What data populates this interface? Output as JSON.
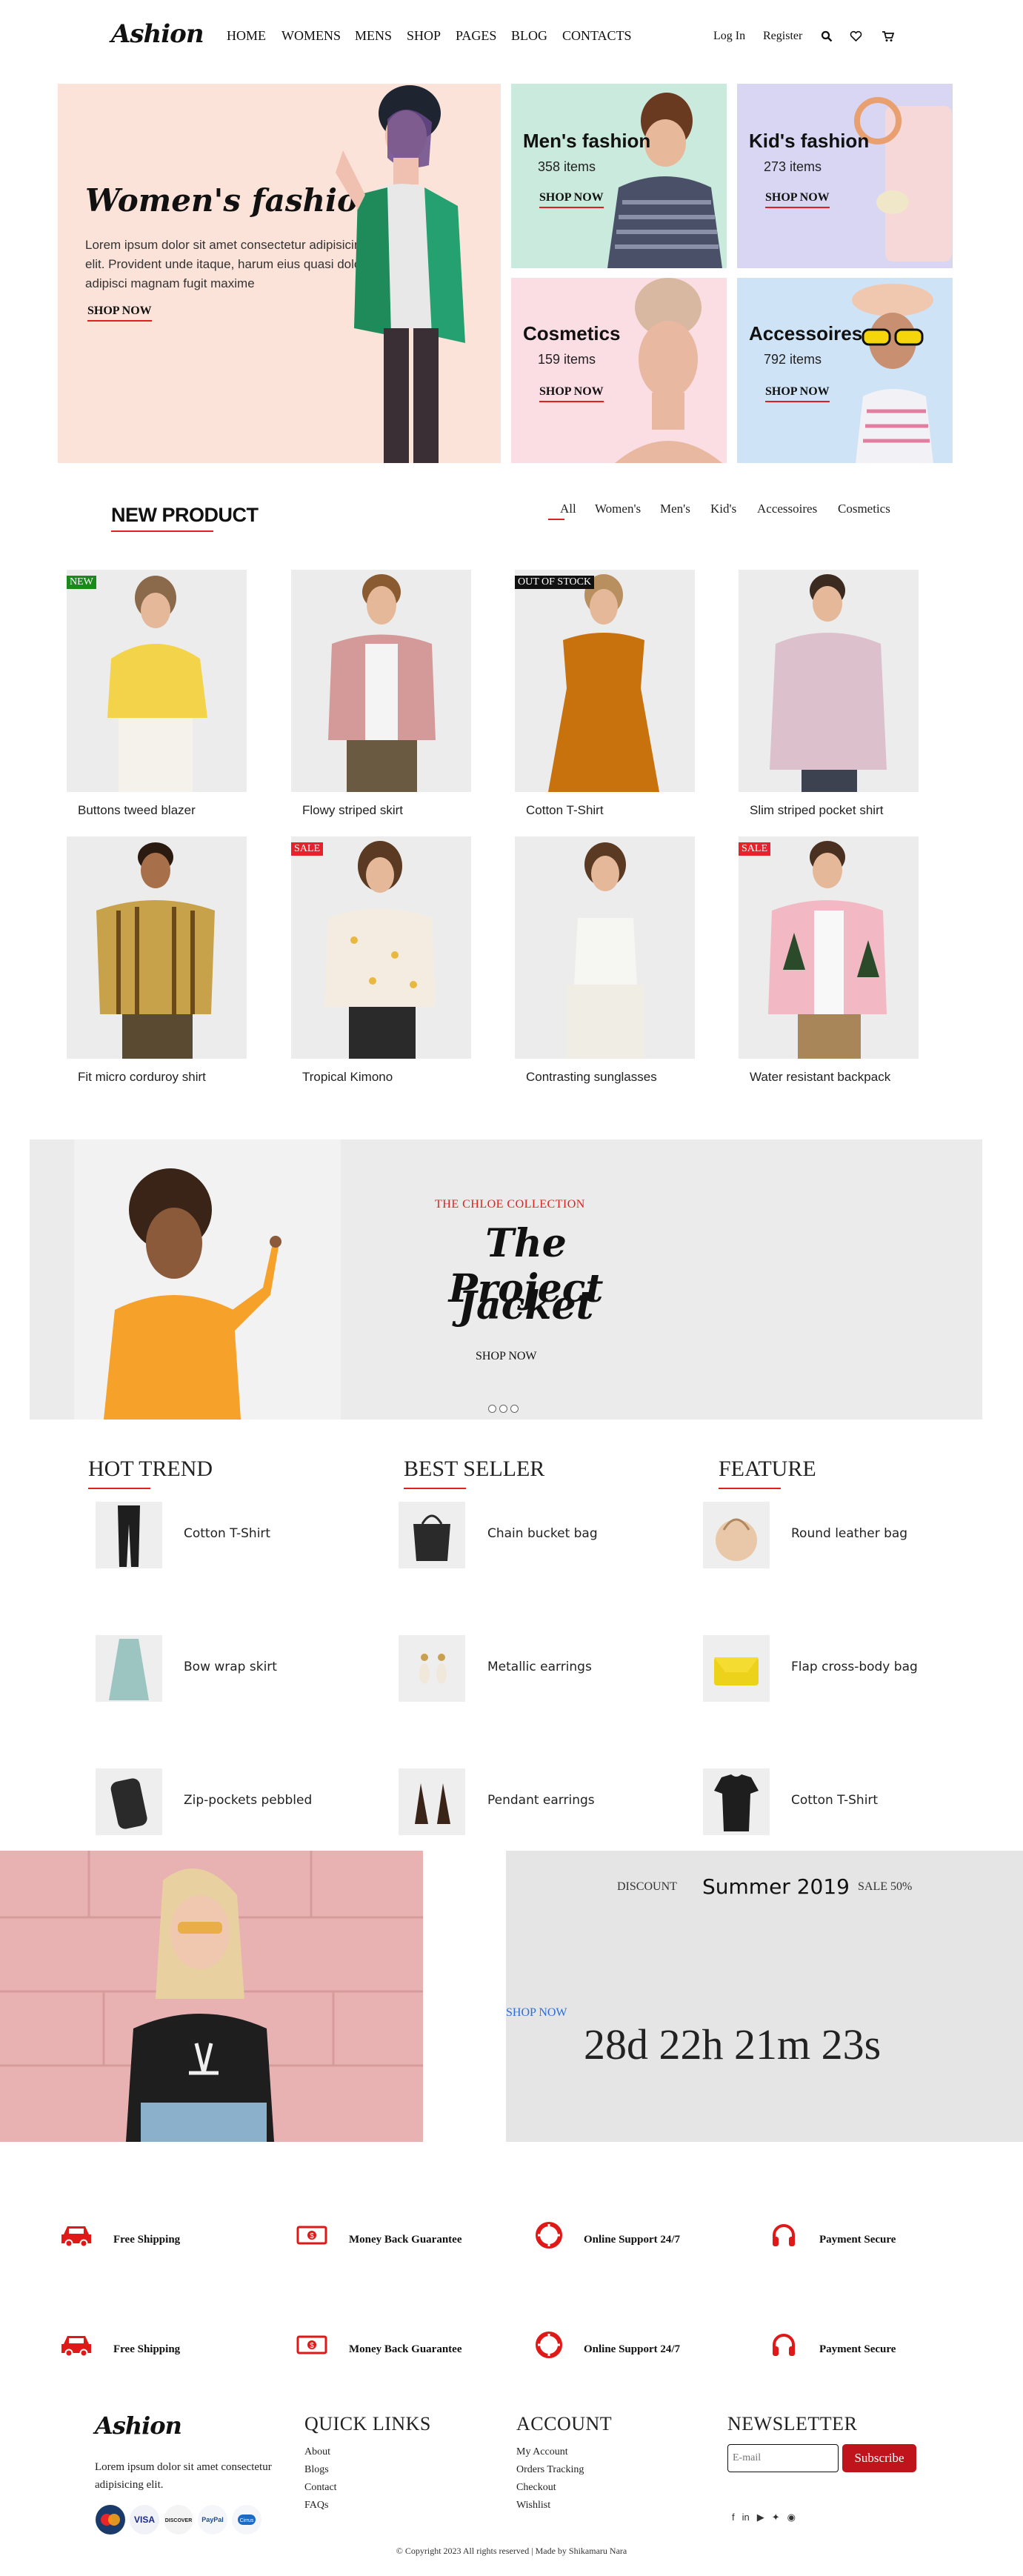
{
  "header": {
    "logo": "Ashion",
    "nav": [
      "HOME",
      "WOMENS",
      "MENS",
      "SHOP",
      "PAGES",
      "BLOG",
      "CONTACTS"
    ],
    "login": "Log In",
    "register": "Register"
  },
  "hero": {
    "main": {
      "title": "Women's fashion",
      "text": "Lorem ipsum dolor sit amet consectetur adipisicing elit. Provident unde itaque, harum eius quasi dolor no adipisci magnam fugit maxime",
      "cta": "SHOP NOW"
    },
    "tiles": [
      {
        "title": "Men's fashion",
        "count": "358 items",
        "cta": "SHOP NOW",
        "bg": "#c9eadc"
      },
      {
        "title": "Kid's fashion",
        "count": "273 items",
        "cta": "SHOP NOW",
        "bg": "#d8d6f3"
      },
      {
        "title": "Cosmetics",
        "count": "159 items",
        "cta": "SHOP NOW",
        "bg": "#fbdde4"
      },
      {
        "title": "Accessoires",
        "count": "792 items",
        "cta": "SHOP NOW",
        "bg": "#cee3f6"
      }
    ]
  },
  "new_product": {
    "title": "NEW PRODUCT",
    "filters": [
      "All",
      "Women's",
      "Men's",
      "Kid's",
      "Accessoires",
      "Cosmetics"
    ],
    "products": [
      {
        "name": "Buttons tweed blazer",
        "badge": "NEW"
      },
      {
        "name": "Flowy striped skirt",
        "badge": ""
      },
      {
        "name": "Cotton T-Shirt",
        "badge": "OUT OF STOCK"
      },
      {
        "name": "Slim striped pocket shirt",
        "badge": ""
      },
      {
        "name": "Fit micro corduroy shirt",
        "badge": ""
      },
      {
        "name": "Tropical Kimono",
        "badge": "SALE"
      },
      {
        "name": "Contrasting sunglasses",
        "badge": ""
      },
      {
        "name": "Water resistant backpack",
        "badge": "SALE"
      }
    ]
  },
  "banner": {
    "eyebrow": "THE CHLOE COLLECTION",
    "title_line1": "The Project",
    "title_line2": "Jacket",
    "cta": "SHOP NOW"
  },
  "lists": [
    {
      "title": "HOT TREND",
      "items": [
        "Cotton T-Shirt",
        "Bow wrap skirt",
        "Zip-pockets pebbled"
      ]
    },
    {
      "title": "BEST SELLER",
      "items": [
        "Chain bucket bag",
        "Metallic earrings",
        "Pendant earrings"
      ]
    },
    {
      "title": "FEATURE",
      "items": [
        "Round leather bag",
        "Flap cross-body bag",
        "Cotton T-Shirt"
      ]
    }
  ],
  "discount": {
    "label": "DISCOUNT",
    "season": "Summer 2019",
    "sale": "SALE 50%",
    "cta": "SHOP NOW",
    "countdown": "28d 22h 21m 23s"
  },
  "services": [
    "Free Shipping",
    "Money Back Guarantee",
    "Online Support 24/7",
    "Payment Secure"
  ],
  "footer": {
    "logo": "Ashion",
    "about": "Lorem ipsum dolor sit amet consectetur adipisicing elit.",
    "quick_links_title": "QUICK LINKS",
    "quick_links": [
      "About",
      "Blogs",
      "Contact",
      "FAQs"
    ],
    "account_title": "ACCOUNT",
    "account_links": [
      "My Account",
      "Orders Tracking",
      "Checkout",
      "Wishlist"
    ],
    "newsletter_title": "NEWSLETTER",
    "email_placeholder": "E-mail",
    "subscribe": "Subscribe",
    "payments": [
      "MasterCard",
      "VISA",
      "DISCOVER",
      "PayPal",
      "Cirrus"
    ],
    "copyright": "© Copyright 2023 All rights reserved | Made by Shikamaru Nara"
  },
  "colors": {
    "accent": "#e02020",
    "new_badge": "#1a8a1a",
    "sale_badge": "#e8222a",
    "stock_badge": "#111111",
    "link_blue": "#2a6ed8"
  }
}
